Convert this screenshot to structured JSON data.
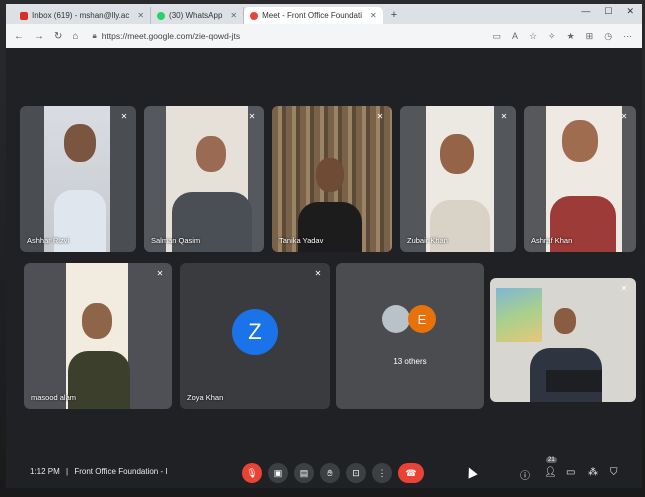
{
  "browser": {
    "tabs": [
      {
        "label": "Inbox (619) - mshan@lly.ac",
        "favicon_color": "#d93025"
      },
      {
        "label": "(30) WhatsApp",
        "favicon_color": "#25d366"
      },
      {
        "label": "Meet - Front Office Foundati",
        "favicon_color": "#ea4335",
        "active": true
      }
    ],
    "new_tab": "+",
    "url": "https://meet.google.com/zie-qowd-jts"
  },
  "participants": [
    {
      "name": "Ashhar Rizvi",
      "muted": true
    },
    {
      "name": "Salman Qasim",
      "muted": true
    },
    {
      "name": "Tanika Yadav",
      "muted": true
    },
    {
      "name": "Zubair Khan",
      "muted": true
    },
    {
      "name": "Ashraf Khan",
      "muted": true
    },
    {
      "name": "masood alam",
      "muted": true
    },
    {
      "name": "Zoya Khan",
      "muted": true,
      "initial": "Z",
      "avatar_color": "#1a73e8"
    },
    {
      "name": "",
      "muted": false
    }
  ],
  "others": {
    "label": "13 others",
    "initial": "E",
    "avatar_color": "#e8710a"
  },
  "bottom_bar": {
    "time": "1:12 PM",
    "separator": "|",
    "meeting_title": "Front Office Foundation - I",
    "people_count": "21"
  },
  "colors": {
    "accent_red": "#ea4335",
    "bg": "#202124",
    "tile": "#3c4043"
  }
}
